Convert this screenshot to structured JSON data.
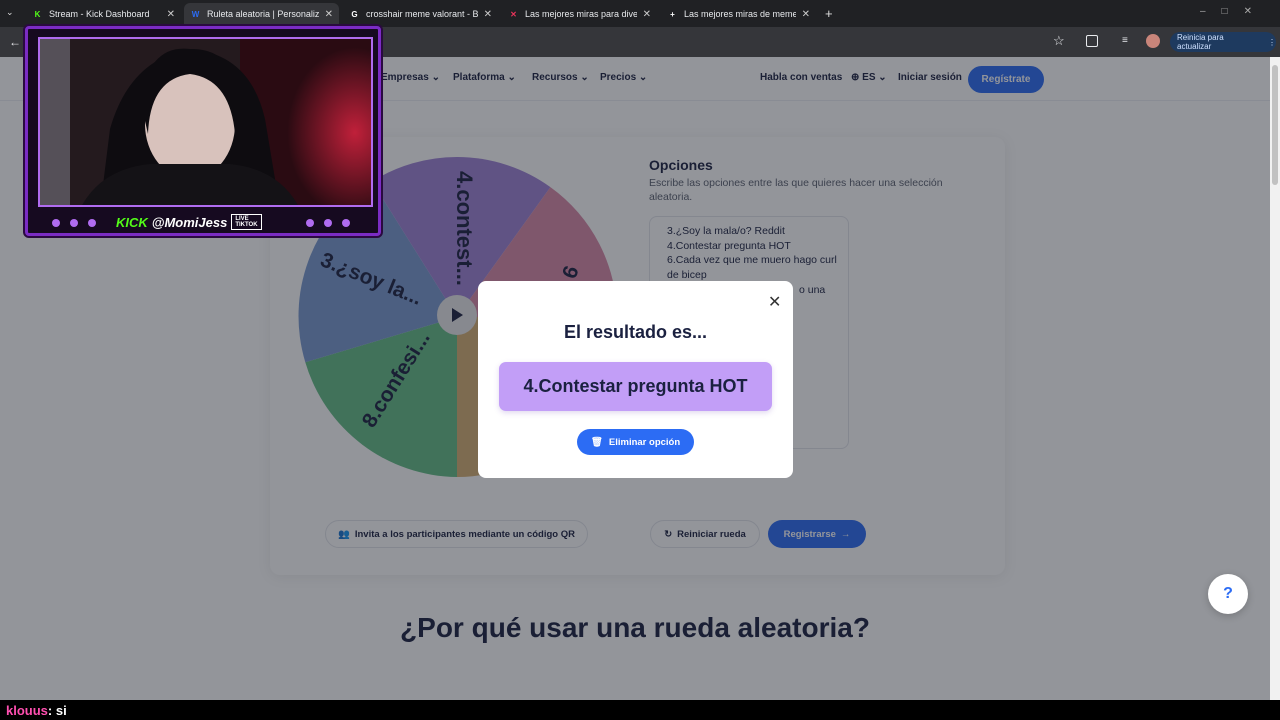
{
  "browser": {
    "tabs": [
      {
        "title": "Stream - Kick Dashboard",
        "favicon": "kick-icon"
      },
      {
        "title": "Ruleta aleatoria | Personaliza y",
        "favicon": "wheel-icon"
      },
      {
        "title": "crosshair meme valorant - Busc",
        "favicon": "google-icon"
      },
      {
        "title": "Las mejores miras para divertir",
        "favicon": "x-icon"
      },
      {
        "title": "Las mejores miras de memes d",
        "favicon": "plus-icon"
      }
    ],
    "update_button": "Reinicia para actualizar"
  },
  "nav": {
    "items": [
      "Empresas",
      "Plataforma",
      "Recursos",
      "Precios"
    ],
    "sales": "Habla con ventas",
    "lang": "ES",
    "login": "Iniciar sesión",
    "signup": "Regístrate"
  },
  "wheel": {
    "labels": [
      "4.contest...",
      "3.¿soy la...",
      "8.confesi...",
      "6"
    ],
    "colors": [
      "#9f82d6",
      "#d98aa9",
      "#7a9ad0",
      "#65bd86",
      "#d6b074"
    ]
  },
  "options": {
    "title": "Opciones",
    "description": "Escribe las opciones entre las que quieres hacer una selección aleatoria.",
    "lines": [
      "3.¿Soy la mala/o? Reddit",
      "4.Contestar pregunta HOT",
      "6.Cada vez que me muero hago curl",
      "de bicep"
    ],
    "partial": "o una"
  },
  "actions": {
    "invite": "Invita a los participantes mediante un código QR",
    "reset": "Reiniciar rueda",
    "register": "Registrarse"
  },
  "modal": {
    "title": "El resultado es...",
    "result": "4.Contestar pregunta HOT",
    "delete": "Eliminar opción"
  },
  "section_heading": "¿Por qué usar una rueda aleatoria?",
  "help": "?",
  "stream": {
    "brand": "KICK",
    "handle": "@MomiJess",
    "badge_top": "LIVE",
    "badge_bottom": "TIKTOK"
  },
  "chat": {
    "user": "klouus",
    "message": ": si"
  }
}
